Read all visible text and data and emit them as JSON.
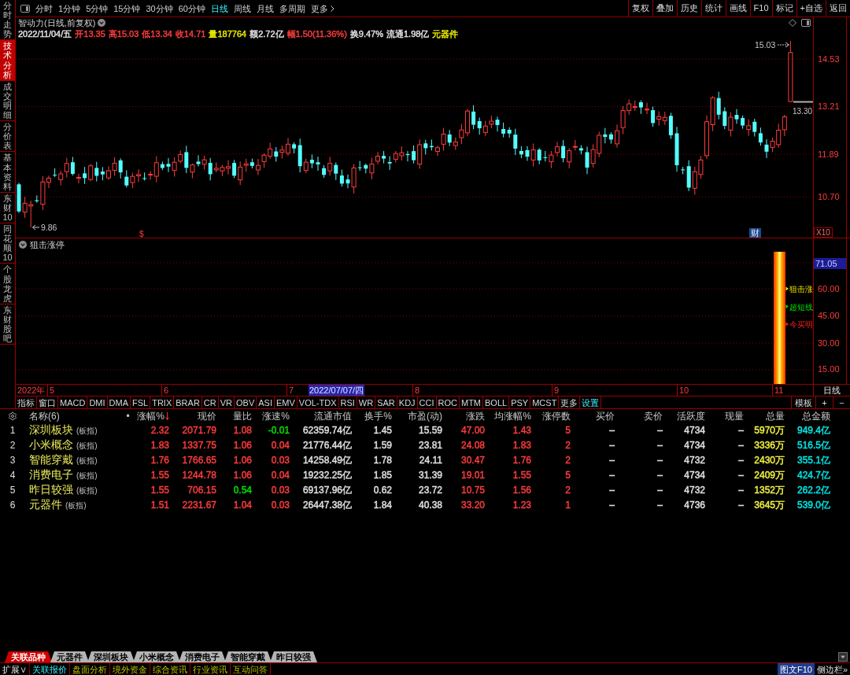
{
  "sidebar": {
    "tabs": [
      {
        "label": "分时走势",
        "selected": false
      },
      {
        "label": "技术分析",
        "selected": true
      },
      {
        "label": "成交明细",
        "selected": false
      },
      {
        "label": "分价表",
        "selected": false
      },
      {
        "label": "基本资料",
        "selected": false
      },
      {
        "label": "东财10",
        "selected": false
      },
      {
        "label": "同花顺10",
        "selected": false
      },
      {
        "label": "个股龙虎",
        "selected": false
      },
      {
        "label": "东财股吧",
        "selected": false
      }
    ]
  },
  "toolbar": {
    "periods": [
      {
        "label": "分时",
        "kind": "period",
        "selected": false
      },
      {
        "label": "1分钟",
        "kind": "period",
        "selected": false
      },
      {
        "label": "5分钟",
        "kind": "period",
        "selected": false
      },
      {
        "label": "15分钟",
        "kind": "period",
        "selected": false
      },
      {
        "label": "30分钟",
        "kind": "period",
        "selected": false
      },
      {
        "label": "60分钟",
        "kind": "period",
        "selected": false
      },
      {
        "label": "日线",
        "kind": "period",
        "selected": true
      },
      {
        "label": "周线",
        "kind": "period",
        "selected": false
      },
      {
        "label": "月线",
        "kind": "period",
        "selected": false
      },
      {
        "label": "多周期",
        "kind": "period",
        "selected": false
      },
      {
        "label": "更多",
        "kind": "menu",
        "selected": false
      }
    ],
    "buttons": [
      "复权",
      "叠加",
      "历史",
      "统计",
      "画线",
      "F10",
      "标记",
      "+自选",
      "返回"
    ]
  },
  "price_chart": {
    "title": "智动力(日线,前复权)",
    "quote": [
      {
        "text": "2022/11/04/五",
        "color": "#e0e0e0"
      },
      {
        "text": "开13.35",
        "color": "#ff3c3c"
      },
      {
        "text": "高15.03",
        "color": "#ff3c3c"
      },
      {
        "text": "低13.34",
        "color": "#ff3c3c"
      },
      {
        "text": "收14.71",
        "color": "#ff3c3c"
      },
      {
        "text": "量187764",
        "color": "#e8e800"
      },
      {
        "text": "额2.72亿",
        "color": "#e0e0e0"
      },
      {
        "text": "幅1.50(11.36%)",
        "color": "#ff3c3c"
      },
      {
        "text": "换9.47%",
        "color": "#e0e0e0"
      },
      {
        "text": "流通1.98亿",
        "color": "#e0e0e0"
      },
      {
        "text": "元器件",
        "color": "#e8e800"
      }
    ],
    "axis_labels": [
      "14.53",
      "13.21",
      "11.89",
      "10.70"
    ],
    "annotations": [
      {
        "kind": "high",
        "text": "15.03"
      },
      {
        "kind": "last",
        "text": "13.30"
      },
      {
        "kind": "low",
        "text": "9.86"
      }
    ],
    "markers": [
      {
        "kind": "event",
        "text": "$"
      },
      {
        "kind": "finance",
        "text": "财"
      }
    ],
    "scale_button": "X10"
  },
  "indicator_panel": {
    "title": "狙击涨停",
    "axis_labels": [
      {
        "kind": "current",
        "text": "71.05"
      },
      {
        "kind": "tick",
        "text": "60.00"
      },
      {
        "kind": "tick",
        "text": "45.00"
      },
      {
        "kind": "tick",
        "text": "30.00"
      },
      {
        "kind": "tick",
        "text": "15.00"
      }
    ],
    "legends": [
      {
        "text": "狙击涨",
        "color": "#e8e800"
      },
      {
        "text": "超短线",
        "color": "#00e000"
      },
      {
        "text": "今买明",
        "color": "#ff2020"
      }
    ]
  },
  "date_axis": {
    "labels": [
      {
        "kind": "year",
        "text": "2022年"
      },
      {
        "kind": "month",
        "text": "5"
      },
      {
        "kind": "month",
        "text": "6"
      },
      {
        "kind": "month",
        "text": "7"
      },
      {
        "kind": "cursor",
        "text": "2022/07/07/四"
      },
      {
        "kind": "month",
        "text": "8"
      },
      {
        "kind": "month",
        "text": "9"
      },
      {
        "kind": "month",
        "text": "10"
      },
      {
        "kind": "month",
        "text": "11"
      }
    ],
    "period_label": "日线"
  },
  "indicator_tabs": {
    "tabs": [
      {
        "label": "指标",
        "selected": false
      },
      {
        "label": "窗口",
        "selected": false
      },
      {
        "label": "MACD",
        "selected": false
      },
      {
        "label": "DMI",
        "selected": false
      },
      {
        "label": "DMA",
        "selected": false
      },
      {
        "label": "FSL",
        "selected": false
      },
      {
        "label": "TRIX",
        "selected": false
      },
      {
        "label": "BRAR",
        "selected": false
      },
      {
        "label": "CR",
        "selected": false
      },
      {
        "label": "VR",
        "selected": false
      },
      {
        "label": "OBV",
        "selected": false
      },
      {
        "label": "ASI",
        "selected": false
      },
      {
        "label": "EMV",
        "selected": false
      },
      {
        "label": "VOL-TDX",
        "selected": false
      },
      {
        "label": "RSI",
        "selected": false
      },
      {
        "label": "WR",
        "selected": false
      },
      {
        "label": "SAR",
        "selected": false
      },
      {
        "label": "KDJ",
        "selected": false
      },
      {
        "label": "CCI",
        "selected": false
      },
      {
        "label": "ROC",
        "selected": false
      },
      {
        "label": "MTM",
        "selected": false
      },
      {
        "label": "BOLL",
        "selected": false
      },
      {
        "label": "PSY",
        "selected": false
      },
      {
        "label": "MCST",
        "selected": false
      },
      {
        "label": "更多",
        "selected": false
      },
      {
        "label": "设置",
        "selected": true
      }
    ],
    "buttons": [
      "模板",
      "+",
      "−"
    ]
  },
  "table": {
    "name_header": "名称(6)",
    "dot_header": "•",
    "columns": [
      {
        "label": "涨幅%",
        "sorted": true
      },
      {
        "label": "现价",
        "sorted": false
      },
      {
        "label": "量比",
        "sorted": false
      },
      {
        "label": "涨速%",
        "sorted": false
      },
      {
        "label": "流通市值",
        "sorted": false
      },
      {
        "label": "换手%",
        "sorted": false
      },
      {
        "label": "市盈(动)",
        "sorted": false
      },
      {
        "label": "涨跌",
        "sorted": false
      },
      {
        "label": "均涨幅%",
        "sorted": false
      },
      {
        "label": "涨停数",
        "sorted": false
      },
      {
        "label": "买价",
        "sorted": false
      },
      {
        "label": "卖价",
        "sorted": false
      },
      {
        "label": "活跃度",
        "sorted": false
      },
      {
        "label": "现量",
        "sorted": false
      },
      {
        "label": "总量",
        "sorted": false
      },
      {
        "label": "总金额",
        "sorted": false
      }
    ],
    "rows": [
      {
        "num": "1",
        "name": "深圳板块",
        "tag": "(板指)",
        "cells": [
          {
            "text": "2.32",
            "color": "#ff3c3c"
          },
          {
            "text": "2071.79",
            "color": "#ff3c3c"
          },
          {
            "text": "1.08",
            "color": "#ff3c3c"
          },
          {
            "text": "-0.01",
            "color": "#00e000"
          },
          {
            "text": "62359.74亿",
            "color": "#e0e0e0"
          },
          {
            "text": "1.45",
            "color": "#e0e0e0"
          },
          {
            "text": "15.59",
            "color": "#e0e0e0"
          },
          {
            "text": "47.00",
            "color": "#ff3c3c"
          },
          {
            "text": "1.43",
            "color": "#ff3c3c"
          },
          {
            "text": "5",
            "color": "#ff3c3c"
          },
          {
            "text": "–",
            "color": "#e0e0e0"
          },
          {
            "text": "–",
            "color": "#e0e0e0"
          },
          {
            "text": "4734",
            "color": "#e0e0e0"
          },
          {
            "text": "–",
            "color": "#e0e0e0"
          },
          {
            "text": "5970万",
            "color": "#f0f040"
          },
          {
            "text": "949.4亿",
            "color": "#00e8e8"
          }
        ]
      },
      {
        "num": "2",
        "name": "小米概念",
        "tag": "(板指)",
        "cells": [
          {
            "text": "1.83",
            "color": "#ff3c3c"
          },
          {
            "text": "1337.75",
            "color": "#ff3c3c"
          },
          {
            "text": "1.06",
            "color": "#ff3c3c"
          },
          {
            "text": "0.04",
            "color": "#ff3c3c"
          },
          {
            "text": "21776.44亿",
            "color": "#e0e0e0"
          },
          {
            "text": "1.59",
            "color": "#e0e0e0"
          },
          {
            "text": "23.81",
            "color": "#e0e0e0"
          },
          {
            "text": "24.08",
            "color": "#ff3c3c"
          },
          {
            "text": "1.83",
            "color": "#ff3c3c"
          },
          {
            "text": "2",
            "color": "#ff3c3c"
          },
          {
            "text": "–",
            "color": "#e0e0e0"
          },
          {
            "text": "–",
            "color": "#e0e0e0"
          },
          {
            "text": "4734",
            "color": "#e0e0e0"
          },
          {
            "text": "–",
            "color": "#e0e0e0"
          },
          {
            "text": "3336万",
            "color": "#f0f040"
          },
          {
            "text": "516.5亿",
            "color": "#00e8e8"
          }
        ]
      },
      {
        "num": "3",
        "name": "智能穿戴",
        "tag": "(板指)",
        "cells": [
          {
            "text": "1.76",
            "color": "#ff3c3c"
          },
          {
            "text": "1766.65",
            "color": "#ff3c3c"
          },
          {
            "text": "1.06",
            "color": "#ff3c3c"
          },
          {
            "text": "0.03",
            "color": "#ff3c3c"
          },
          {
            "text": "14258.49亿",
            "color": "#e0e0e0"
          },
          {
            "text": "1.78",
            "color": "#e0e0e0"
          },
          {
            "text": "24.11",
            "color": "#e0e0e0"
          },
          {
            "text": "30.47",
            "color": "#ff3c3c"
          },
          {
            "text": "1.76",
            "color": "#ff3c3c"
          },
          {
            "text": "2",
            "color": "#ff3c3c"
          },
          {
            "text": "–",
            "color": "#e0e0e0"
          },
          {
            "text": "–",
            "color": "#e0e0e0"
          },
          {
            "text": "4732",
            "color": "#e0e0e0"
          },
          {
            "text": "–",
            "color": "#e0e0e0"
          },
          {
            "text": "2430万",
            "color": "#f0f040"
          },
          {
            "text": "355.1亿",
            "color": "#00e8e8"
          }
        ]
      },
      {
        "num": "4",
        "name": "消费电子",
        "tag": "(板指)",
        "cells": [
          {
            "text": "1.55",
            "color": "#ff3c3c"
          },
          {
            "text": "1244.78",
            "color": "#ff3c3c"
          },
          {
            "text": "1.06",
            "color": "#ff3c3c"
          },
          {
            "text": "0.04",
            "color": "#ff3c3c"
          },
          {
            "text": "19232.25亿",
            "color": "#e0e0e0"
          },
          {
            "text": "1.85",
            "color": "#e0e0e0"
          },
          {
            "text": "31.39",
            "color": "#e0e0e0"
          },
          {
            "text": "19.01",
            "color": "#ff3c3c"
          },
          {
            "text": "1.55",
            "color": "#ff3c3c"
          },
          {
            "text": "5",
            "color": "#ff3c3c"
          },
          {
            "text": "–",
            "color": "#e0e0e0"
          },
          {
            "text": "–",
            "color": "#e0e0e0"
          },
          {
            "text": "4734",
            "color": "#e0e0e0"
          },
          {
            "text": "–",
            "color": "#e0e0e0"
          },
          {
            "text": "2409万",
            "color": "#f0f040"
          },
          {
            "text": "424.7亿",
            "color": "#00e8e8"
          }
        ]
      },
      {
        "num": "5",
        "name": "昨日较强",
        "tag": "(板指)",
        "cells": [
          {
            "text": "1.55",
            "color": "#ff3c3c"
          },
          {
            "text": "706.15",
            "color": "#ff3c3c"
          },
          {
            "text": "0.54",
            "color": "#00e000"
          },
          {
            "text": "0.03",
            "color": "#ff3c3c"
          },
          {
            "text": "69137.96亿",
            "color": "#e0e0e0"
          },
          {
            "text": "0.62",
            "color": "#e0e0e0"
          },
          {
            "text": "23.72",
            "color": "#e0e0e0"
          },
          {
            "text": "10.75",
            "color": "#ff3c3c"
          },
          {
            "text": "1.56",
            "color": "#ff3c3c"
          },
          {
            "text": "2",
            "color": "#ff3c3c"
          },
          {
            "text": "–",
            "color": "#e0e0e0"
          },
          {
            "text": "–",
            "color": "#e0e0e0"
          },
          {
            "text": "4732",
            "color": "#e0e0e0"
          },
          {
            "text": "–",
            "color": "#e0e0e0"
          },
          {
            "text": "1352万",
            "color": "#f0f040"
          },
          {
            "text": "262.2亿",
            "color": "#00e8e8"
          }
        ]
      },
      {
        "num": "6",
        "name": "元器件",
        "tag": "(板指)",
        "cells": [
          {
            "text": "1.51",
            "color": "#ff3c3c"
          },
          {
            "text": "2231.67",
            "color": "#ff3c3c"
          },
          {
            "text": "1.04",
            "color": "#ff3c3c"
          },
          {
            "text": "0.03",
            "color": "#ff3c3c"
          },
          {
            "text": "26447.38亿",
            "color": "#e0e0e0"
          },
          {
            "text": "1.84",
            "color": "#e0e0e0"
          },
          {
            "text": "40.38",
            "color": "#e0e0e0"
          },
          {
            "text": "33.20",
            "color": "#ff3c3c"
          },
          {
            "text": "1.23",
            "color": "#ff3c3c"
          },
          {
            "text": "1",
            "color": "#ff3c3c"
          },
          {
            "text": "–",
            "color": "#e0e0e0"
          },
          {
            "text": "–",
            "color": "#e0e0e0"
          },
          {
            "text": "4736",
            "color": "#e0e0e0"
          },
          {
            "text": "–",
            "color": "#e0e0e0"
          },
          {
            "text": "3645万",
            "color": "#f0f040"
          },
          {
            "text": "539.0亿",
            "color": "#00e8e8"
          }
        ]
      }
    ]
  },
  "bottom_tabs": [
    {
      "label": "关联品种",
      "selected": true
    },
    {
      "label": "元器件",
      "selected": false
    },
    {
      "label": "深圳板块",
      "selected": false
    },
    {
      "label": "小米概念",
      "selected": false
    },
    {
      "label": "消费电子",
      "selected": false
    },
    {
      "label": "智能穿戴",
      "selected": false
    },
    {
      "label": "昨日较强",
      "selected": false
    }
  ],
  "status_bar": {
    "items": [
      {
        "label": "扩展∨",
        "kind": "menu",
        "selected": false
      },
      {
        "label": "关联报价",
        "kind": "tab",
        "selected": true
      },
      {
        "label": "盘面分析",
        "kind": "tab",
        "selected": false
      },
      {
        "label": "境外资金",
        "kind": "tab",
        "selected": false
      },
      {
        "label": "综合资讯",
        "kind": "tab",
        "selected": false
      },
      {
        "label": "行业资讯",
        "kind": "tab",
        "selected": false
      },
      {
        "label": "互动问答",
        "kind": "tab",
        "selected": false
      }
    ],
    "right_buttons": [
      {
        "label": "图文F10",
        "selected": true
      },
      {
        "label": "侧边栏»",
        "selected": false
      }
    ]
  }
}
